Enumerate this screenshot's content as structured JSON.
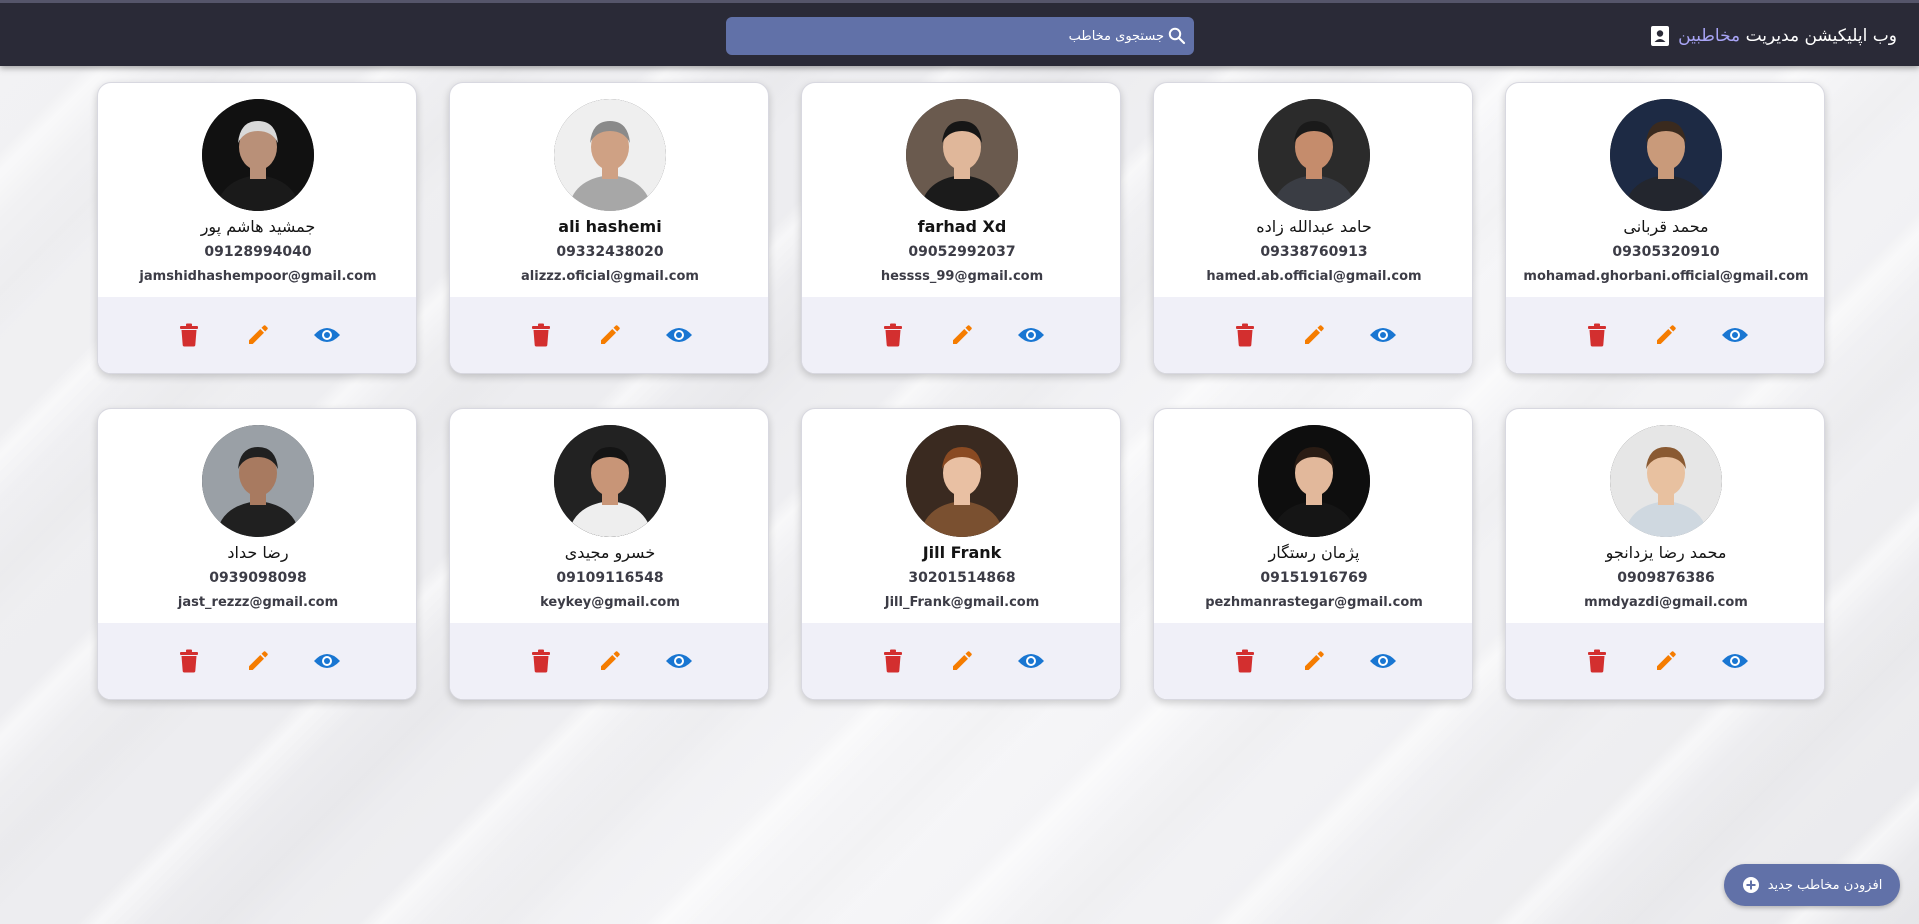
{
  "header": {
    "title_prefix": "وب اپلیکیشن مدیریت",
    "title_accent": "مخاطبین",
    "icon": "contact-book-icon"
  },
  "search": {
    "placeholder": "جستجوی مخاطب",
    "icon": "search-icon"
  },
  "add_button": {
    "label": "افزودن مخاطب جدید",
    "icon": "plus-circle-icon"
  },
  "colors": {
    "navbar": "#2a2a37",
    "accent": "#a8a4f5",
    "search_bg": "#6171a8",
    "delete": "#d32f2f",
    "edit": "#f57c00",
    "view": "#1976d2"
  },
  "contacts": [
    {
      "name": "محمد قربانی",
      "phone": "09305320910",
      "email": "mohamad.ghorbani.official@gmail.com"
    },
    {
      "name": "حامد عبدالله زاده",
      "phone": "09338760913",
      "email": "hamed.ab.official@gmail.com"
    },
    {
      "name": "farhad Xd",
      "phone": "09052992037",
      "email": "hessss_99@gmail.com"
    },
    {
      "name": "ali hashemi",
      "phone": "09332438020",
      "email": "alizzz.oficial@gmail.com"
    },
    {
      "name": "جمشید هاشم پور",
      "phone": "09128994040",
      "email": "jamshidhashempoor@gmail.com"
    },
    {
      "name": "محمد رضا یزدانجو",
      "phone": "0909876386",
      "email": "mmdyazdi@gmail.com"
    },
    {
      "name": "پژمان رستگار",
      "phone": "09151916769",
      "email": "pezhmanrastegar@gmail.com"
    },
    {
      "name": "Jill Frank",
      "phone": "30201514868",
      "email": "Jill_Frank@gmail.com"
    },
    {
      "name": "خسرو مجیدی",
      "phone": "09109116548",
      "email": "keykey@gmail.com"
    },
    {
      "name": "رضا حداد",
      "phone": "0939098098",
      "email": "jast_rezzz@gmail.com"
    }
  ]
}
